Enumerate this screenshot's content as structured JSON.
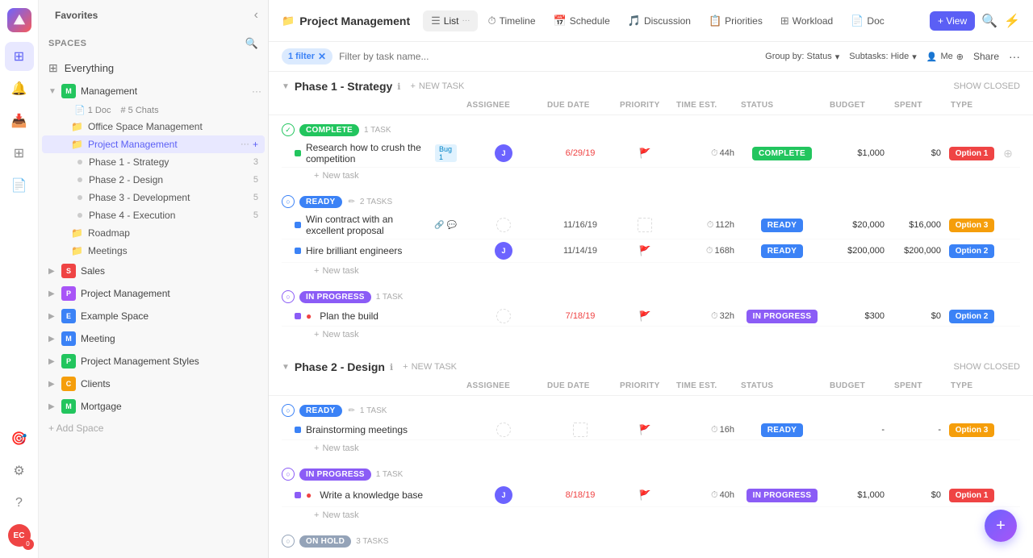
{
  "app": {
    "logo_text": "C",
    "favorites_label": "Favorites",
    "spaces_label": "Spaces"
  },
  "sidebar": {
    "everything_label": "Everything",
    "spaces": [
      {
        "id": "management",
        "name": "Management",
        "icon": "M",
        "icon_class": "icon-m",
        "expanded": true,
        "doc_count": "1 Doc",
        "chat_count": "5 Chats",
        "children": [
          {
            "name": "Office Space Management",
            "type": "folder"
          },
          {
            "name": "Project Management",
            "type": "folder",
            "active": true,
            "sub": [
              {
                "name": "Phase 1 - Strategy",
                "count": "3"
              },
              {
                "name": "Phase 2 - Design",
                "count": "5"
              },
              {
                "name": "Phase 3 - Development",
                "count": "5"
              },
              {
                "name": "Phase 4 - Execution",
                "count": "5"
              }
            ]
          },
          {
            "name": "Roadmap",
            "type": "folder"
          },
          {
            "name": "Meetings",
            "type": "folder"
          }
        ]
      },
      {
        "id": "sales",
        "name": "Sales",
        "icon": "S",
        "icon_class": "icon-s"
      },
      {
        "id": "project-mgmt",
        "name": "Project Management",
        "icon": "P",
        "icon_class": "icon-p"
      },
      {
        "id": "example",
        "name": "Example Space",
        "icon": "E",
        "icon_class": "icon-e"
      },
      {
        "id": "meeting",
        "name": "Meeting",
        "icon": "M",
        "icon_class": "icon-meet"
      },
      {
        "id": "pm-styles",
        "name": "Project Management Styles",
        "icon": "P",
        "icon_class": "icon-pm"
      },
      {
        "id": "clients",
        "name": "Clients",
        "icon": "C",
        "icon_class": "icon-c"
      },
      {
        "id": "mortgage",
        "name": "Mortgage",
        "icon": "M",
        "icon_class": "icon-mort"
      }
    ],
    "add_space_label": "+ Add Space"
  },
  "topbar": {
    "project_icon": "📁",
    "title": "Project Management",
    "tabs": [
      {
        "id": "list",
        "label": "List",
        "icon": "☰",
        "active": true
      },
      {
        "id": "timeline",
        "label": "Timeline",
        "icon": "⏱"
      },
      {
        "id": "schedule",
        "label": "Schedule",
        "icon": "📅"
      },
      {
        "id": "discussion",
        "label": "Discussion",
        "icon": "🎵"
      },
      {
        "id": "priorities",
        "label": "Priorities",
        "icon": "📋"
      },
      {
        "id": "workload",
        "label": "Workload",
        "icon": "⊞"
      },
      {
        "id": "doc",
        "label": "Doc",
        "icon": "📄"
      }
    ],
    "view_label": "+ View",
    "more_label": "···"
  },
  "filterbar": {
    "filter_badge": "1 filter",
    "filter_placeholder": "Filter by task name...",
    "group_by_label": "Group by: Status",
    "subtasks_label": "Subtasks: Hide",
    "me_label": "Me",
    "share_label": "Share"
  },
  "table_headers": {
    "assignee": "ASSIGNEE",
    "due_date": "DUE DATE",
    "priority": "PRIORITY",
    "time_est": "TIME EST.",
    "status": "STATUS",
    "budget": "BUDGET",
    "spent": "SPENT",
    "type": "TYPE"
  },
  "phases": [
    {
      "id": "phase1",
      "title": "Phase 1 - Strategy",
      "add_task_label": "+ NEW TASK",
      "show_closed_label": "SHOW CLOSED",
      "groups": [
        {
          "status": "COMPLETE",
          "status_class": "chip-complete",
          "task_count": "1 TASK",
          "tasks": [
            {
              "name": "Research how to crush the competition",
              "tag": "Bug 1",
              "assignee": "J",
              "assignee_bg": "#6c63ff",
              "due_date": "6/29/19",
              "due_class": "due-date",
              "priority": "🚩",
              "priority_class": "priority-flag-red",
              "time_est": "44h",
              "status": "COMPLETE",
              "status_class": "badge-complete",
              "budget": "$1,000",
              "spent": "$0",
              "type": "Option 1",
              "type_class": "type-opt1"
            }
          ]
        },
        {
          "status": "READY",
          "status_class": "chip-ready",
          "task_count": "2 TASKS",
          "tasks": [
            {
              "name": "Win contract with an excellent proposal",
              "tag": null,
              "assignee": null,
              "assignee_bg": null,
              "due_date": "11/16/19",
              "due_class": "due-date-normal",
              "priority": "◻",
              "priority_class": "priority-empty",
              "time_est": "112h",
              "status": "READY",
              "status_class": "badge-ready",
              "budget": "$20,000",
              "spent": "$16,000",
              "type": "Option 3",
              "type_class": "type-opt3"
            },
            {
              "name": "Hire brilliant engineers",
              "tag": null,
              "assignee": "J",
              "assignee_bg": "#6c63ff",
              "due_date": "11/14/19",
              "due_class": "due-date-normal",
              "priority": "🚩",
              "priority_class": "priority-flag-yellow",
              "time_est": "168h",
              "status": "READY",
              "status_class": "badge-ready",
              "budget": "$200,000",
              "spent": "$200,000",
              "type": "Option 2",
              "type_class": "type-opt2"
            }
          ]
        },
        {
          "status": "IN PROGRESS",
          "status_class": "chip-in-progress",
          "task_count": "1 TASK",
          "tasks": [
            {
              "name": "Plan the build",
              "tag": null,
              "assignee": null,
              "assignee_bg": null,
              "due_date": "7/18/19",
              "due_class": "due-date",
              "priority": "🚩",
              "priority_class": "priority-flag-yellow",
              "time_est": "32h",
              "status": "IN PROGRESS",
              "status_class": "badge-in-progress",
              "budget": "$300",
              "spent": "$0",
              "type": "Option 2",
              "type_class": "type-opt2"
            }
          ]
        }
      ]
    },
    {
      "id": "phase2",
      "title": "Phase 2 - Design",
      "add_task_label": "+ NEW TASK",
      "show_closed_label": "SHOW CLOSED",
      "groups": [
        {
          "status": "READY",
          "status_class": "chip-ready",
          "task_count": "1 TASK",
          "tasks": [
            {
              "name": "Brainstorming meetings",
              "tag": null,
              "assignee": null,
              "assignee_bg": null,
              "due_date": null,
              "due_class": "due-date-normal",
              "priority": "◻",
              "priority_class": "priority-flag-blue",
              "time_est": "16h",
              "status": "READY",
              "status_class": "badge-ready",
              "budget": "-",
              "spent": "-",
              "type": "Option 3",
              "type_class": "type-opt3"
            }
          ]
        },
        {
          "status": "IN PROGRESS",
          "status_class": "chip-in-progress",
          "task_count": "1 TASK",
          "tasks": [
            {
              "name": "Write a knowledge base",
              "tag": null,
              "assignee": "J",
              "assignee_bg": "#6c63ff",
              "due_date": "8/18/19",
              "due_class": "due-date",
              "priority": "◻",
              "priority_class": "priority-flag-blue",
              "time_est": "40h",
              "status": "IN PROGRESS",
              "status_class": "badge-in-progress",
              "budget": "$1,000",
              "spent": "$0",
              "type": "Option 1",
              "type_class": "type-opt1"
            }
          ]
        },
        {
          "status": "ON HOLD",
          "status_class": "chip-on-hold",
          "task_count": "3 TASKS",
          "tasks": []
        }
      ]
    }
  ],
  "new_task_label": "+ New task",
  "fab_icon": "+"
}
